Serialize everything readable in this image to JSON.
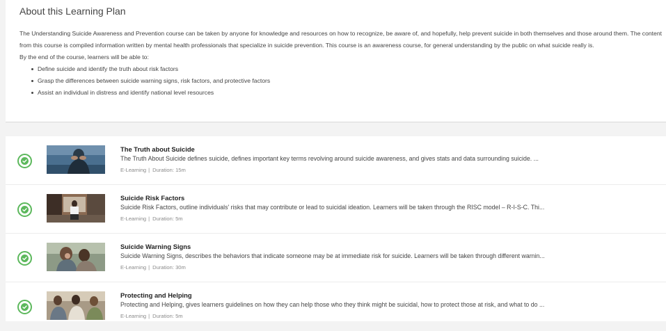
{
  "about": {
    "title": "About this Learning Plan",
    "description": "The Understanding Suicide Awareness and Prevention course can be taken by anyone for knowledge and resources on how to recognize, be aware of, and hopefully, help prevent suicide in both themselves and those around them. The content from this course is compiled information written by mental health professionals that specialize in suicide prevention. This course is an awareness course, for general understanding by the public on what suicide really is.",
    "intro": "By the end of the course, learners will be able to:",
    "objectives": [
      "Define suicide and identify the truth about risk factors",
      "Grasp the differences between suicide warning signs, risk factors, and protective factors",
      "Assist an individual in distress and identify national level resources"
    ]
  },
  "courses": [
    {
      "title": "The Truth about Suicide",
      "description": "    The Truth About Suicide defines suicide, defines important key terms revolving around suicide awareness, and gives stats and data surrounding suicide. ...",
      "type": "E-Learning",
      "duration": "Duration: 15m",
      "status": "completed",
      "thumbnail": "person-distressed-photo"
    },
    {
      "title": "Suicide Risk Factors",
      "description": "Suicide Risk Factors, outline individuals' risks that may contribute or lead to suicidal ideation. Learners will be taken through the RISC model – R-I-S-C. Thi...",
      "type": "E-Learning",
      "duration": "Duration: 5m",
      "status": "completed",
      "thumbnail": "person-sitting-alone-photo"
    },
    {
      "title": "Suicide Warning Signs",
      "description": "Suicide Warning Signs, describes the behaviors that indicate someone may be at immediate risk for suicide. Learners will be taken through different warnin...",
      "type": "E-Learning",
      "duration": "Duration: 30m",
      "status": "completed",
      "thumbnail": "comforting-friend-photo"
    },
    {
      "title": "Protecting and Helping",
      "description": "Protecting and Helping, gives learners guidelines on how they can help those who they think might be suicidal, how to protect those at risk, and what to do ...",
      "type": "E-Learning",
      "duration": "Duration: 5m",
      "status": "completed",
      "thumbnail": "group-support-photo"
    }
  ],
  "colors": {
    "complete_green": "#5cb85c",
    "meta_gray": "#8a8a8a"
  }
}
